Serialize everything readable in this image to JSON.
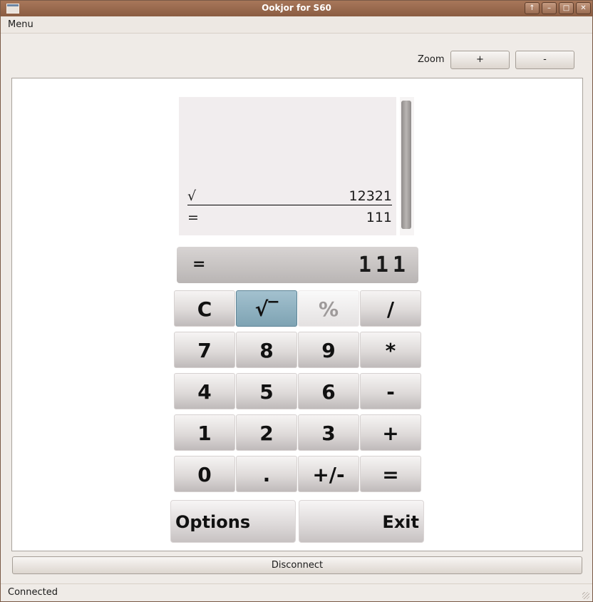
{
  "window": {
    "title": "Ookjor for S60"
  },
  "menubar": {
    "menu_label": "Menu"
  },
  "zoom": {
    "label": "Zoom",
    "plus_label": "+",
    "minus_label": "-"
  },
  "calculator": {
    "history": [
      {
        "op": "√",
        "value": "12321"
      },
      {
        "op": "=",
        "value": "111"
      }
    ],
    "display": {
      "op": "=",
      "value": "111"
    },
    "keys": [
      {
        "label": "C",
        "name": "key-clear"
      },
      {
        "label": "√‾",
        "name": "key-sqrt",
        "state": "active"
      },
      {
        "label": "%",
        "name": "key-percent",
        "state": "disabled"
      },
      {
        "label": "/",
        "name": "key-divide"
      },
      {
        "label": "7",
        "name": "key-7"
      },
      {
        "label": "8",
        "name": "key-8"
      },
      {
        "label": "9",
        "name": "key-9"
      },
      {
        "label": "*",
        "name": "key-multiply"
      },
      {
        "label": "4",
        "name": "key-4"
      },
      {
        "label": "5",
        "name": "key-5"
      },
      {
        "label": "6",
        "name": "key-6"
      },
      {
        "label": "-",
        "name": "key-subtract"
      },
      {
        "label": "1",
        "name": "key-1"
      },
      {
        "label": "2",
        "name": "key-2"
      },
      {
        "label": "3",
        "name": "key-3"
      },
      {
        "label": "+",
        "name": "key-add"
      },
      {
        "label": "0",
        "name": "key-0"
      },
      {
        "label": ".",
        "name": "key-decimal"
      },
      {
        "label": "+/-",
        "name": "key-negate"
      },
      {
        "label": "=",
        "name": "key-equals"
      }
    ],
    "softkeys": {
      "left": "Options",
      "right": "Exit"
    }
  },
  "actions": {
    "disconnect_label": "Disconnect"
  },
  "status": {
    "text": "Connected"
  },
  "icons": {
    "app": "window-app-icon",
    "up": "up-arrow-icon",
    "minimize": "minimize-icon",
    "maximize": "maximize-icon",
    "close": "close-icon"
  }
}
